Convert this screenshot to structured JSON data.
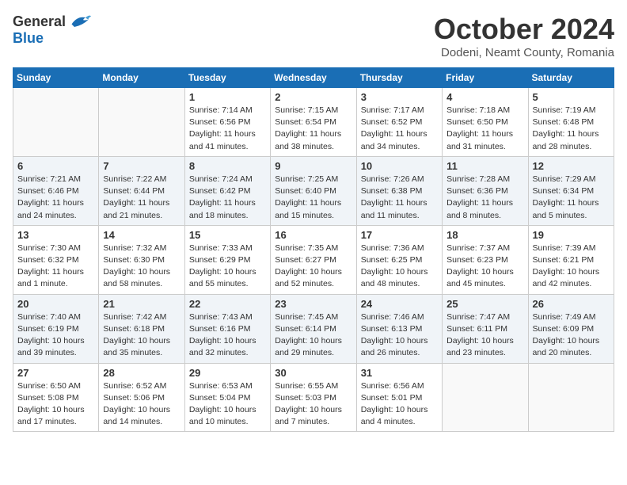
{
  "logo": {
    "general": "General",
    "blue": "Blue"
  },
  "title": {
    "month": "October 2024",
    "location": "Dodeni, Neamt County, Romania"
  },
  "weekdays": [
    "Sunday",
    "Monday",
    "Tuesday",
    "Wednesday",
    "Thursday",
    "Friday",
    "Saturday"
  ],
  "weeks": [
    [
      {
        "day": "",
        "info": ""
      },
      {
        "day": "",
        "info": ""
      },
      {
        "day": "1",
        "info": "Sunrise: 7:14 AM\nSunset: 6:56 PM\nDaylight: 11 hours and 41 minutes."
      },
      {
        "day": "2",
        "info": "Sunrise: 7:15 AM\nSunset: 6:54 PM\nDaylight: 11 hours and 38 minutes."
      },
      {
        "day": "3",
        "info": "Sunrise: 7:17 AM\nSunset: 6:52 PM\nDaylight: 11 hours and 34 minutes."
      },
      {
        "day": "4",
        "info": "Sunrise: 7:18 AM\nSunset: 6:50 PM\nDaylight: 11 hours and 31 minutes."
      },
      {
        "day": "5",
        "info": "Sunrise: 7:19 AM\nSunset: 6:48 PM\nDaylight: 11 hours and 28 minutes."
      }
    ],
    [
      {
        "day": "6",
        "info": "Sunrise: 7:21 AM\nSunset: 6:46 PM\nDaylight: 11 hours and 24 minutes."
      },
      {
        "day": "7",
        "info": "Sunrise: 7:22 AM\nSunset: 6:44 PM\nDaylight: 11 hours and 21 minutes."
      },
      {
        "day": "8",
        "info": "Sunrise: 7:24 AM\nSunset: 6:42 PM\nDaylight: 11 hours and 18 minutes."
      },
      {
        "day": "9",
        "info": "Sunrise: 7:25 AM\nSunset: 6:40 PM\nDaylight: 11 hours and 15 minutes."
      },
      {
        "day": "10",
        "info": "Sunrise: 7:26 AM\nSunset: 6:38 PM\nDaylight: 11 hours and 11 minutes."
      },
      {
        "day": "11",
        "info": "Sunrise: 7:28 AM\nSunset: 6:36 PM\nDaylight: 11 hours and 8 minutes."
      },
      {
        "day": "12",
        "info": "Sunrise: 7:29 AM\nSunset: 6:34 PM\nDaylight: 11 hours and 5 minutes."
      }
    ],
    [
      {
        "day": "13",
        "info": "Sunrise: 7:30 AM\nSunset: 6:32 PM\nDaylight: 11 hours and 1 minute."
      },
      {
        "day": "14",
        "info": "Sunrise: 7:32 AM\nSunset: 6:30 PM\nDaylight: 10 hours and 58 minutes."
      },
      {
        "day": "15",
        "info": "Sunrise: 7:33 AM\nSunset: 6:29 PM\nDaylight: 10 hours and 55 minutes."
      },
      {
        "day": "16",
        "info": "Sunrise: 7:35 AM\nSunset: 6:27 PM\nDaylight: 10 hours and 52 minutes."
      },
      {
        "day": "17",
        "info": "Sunrise: 7:36 AM\nSunset: 6:25 PM\nDaylight: 10 hours and 48 minutes."
      },
      {
        "day": "18",
        "info": "Sunrise: 7:37 AM\nSunset: 6:23 PM\nDaylight: 10 hours and 45 minutes."
      },
      {
        "day": "19",
        "info": "Sunrise: 7:39 AM\nSunset: 6:21 PM\nDaylight: 10 hours and 42 minutes."
      }
    ],
    [
      {
        "day": "20",
        "info": "Sunrise: 7:40 AM\nSunset: 6:19 PM\nDaylight: 10 hours and 39 minutes."
      },
      {
        "day": "21",
        "info": "Sunrise: 7:42 AM\nSunset: 6:18 PM\nDaylight: 10 hours and 35 minutes."
      },
      {
        "day": "22",
        "info": "Sunrise: 7:43 AM\nSunset: 6:16 PM\nDaylight: 10 hours and 32 minutes."
      },
      {
        "day": "23",
        "info": "Sunrise: 7:45 AM\nSunset: 6:14 PM\nDaylight: 10 hours and 29 minutes."
      },
      {
        "day": "24",
        "info": "Sunrise: 7:46 AM\nSunset: 6:13 PM\nDaylight: 10 hours and 26 minutes."
      },
      {
        "day": "25",
        "info": "Sunrise: 7:47 AM\nSunset: 6:11 PM\nDaylight: 10 hours and 23 minutes."
      },
      {
        "day": "26",
        "info": "Sunrise: 7:49 AM\nSunset: 6:09 PM\nDaylight: 10 hours and 20 minutes."
      }
    ],
    [
      {
        "day": "27",
        "info": "Sunrise: 6:50 AM\nSunset: 5:08 PM\nDaylight: 10 hours and 17 minutes."
      },
      {
        "day": "28",
        "info": "Sunrise: 6:52 AM\nSunset: 5:06 PM\nDaylight: 10 hours and 14 minutes."
      },
      {
        "day": "29",
        "info": "Sunrise: 6:53 AM\nSunset: 5:04 PM\nDaylight: 10 hours and 10 minutes."
      },
      {
        "day": "30",
        "info": "Sunrise: 6:55 AM\nSunset: 5:03 PM\nDaylight: 10 hours and 7 minutes."
      },
      {
        "day": "31",
        "info": "Sunrise: 6:56 AM\nSunset: 5:01 PM\nDaylight: 10 hours and 4 minutes."
      },
      {
        "day": "",
        "info": ""
      },
      {
        "day": "",
        "info": ""
      }
    ]
  ]
}
